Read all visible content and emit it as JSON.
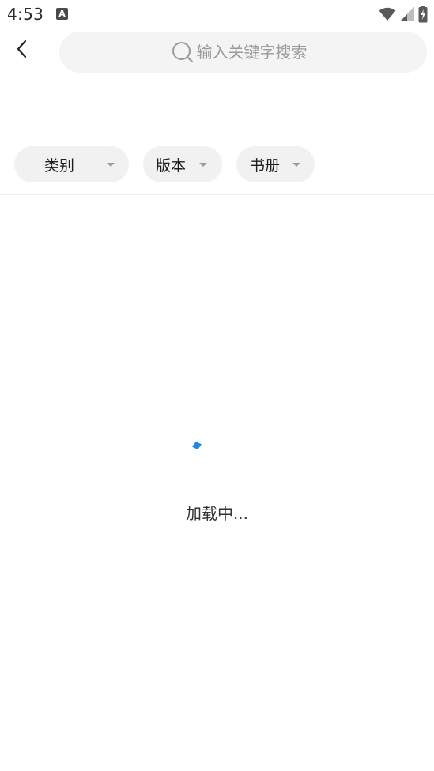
{
  "status_bar": {
    "time": "4:53",
    "notification_icon": "A"
  },
  "header": {
    "back_icon": "chevron-left-icon",
    "search": {
      "placeholder": "输入关键字搜索",
      "value": ""
    }
  },
  "filters": [
    {
      "label": "类别"
    },
    {
      "label": "版本"
    },
    {
      "label": "书册"
    }
  ],
  "loading": {
    "text": "加载中...",
    "spinner_color": "#1e88e5"
  }
}
